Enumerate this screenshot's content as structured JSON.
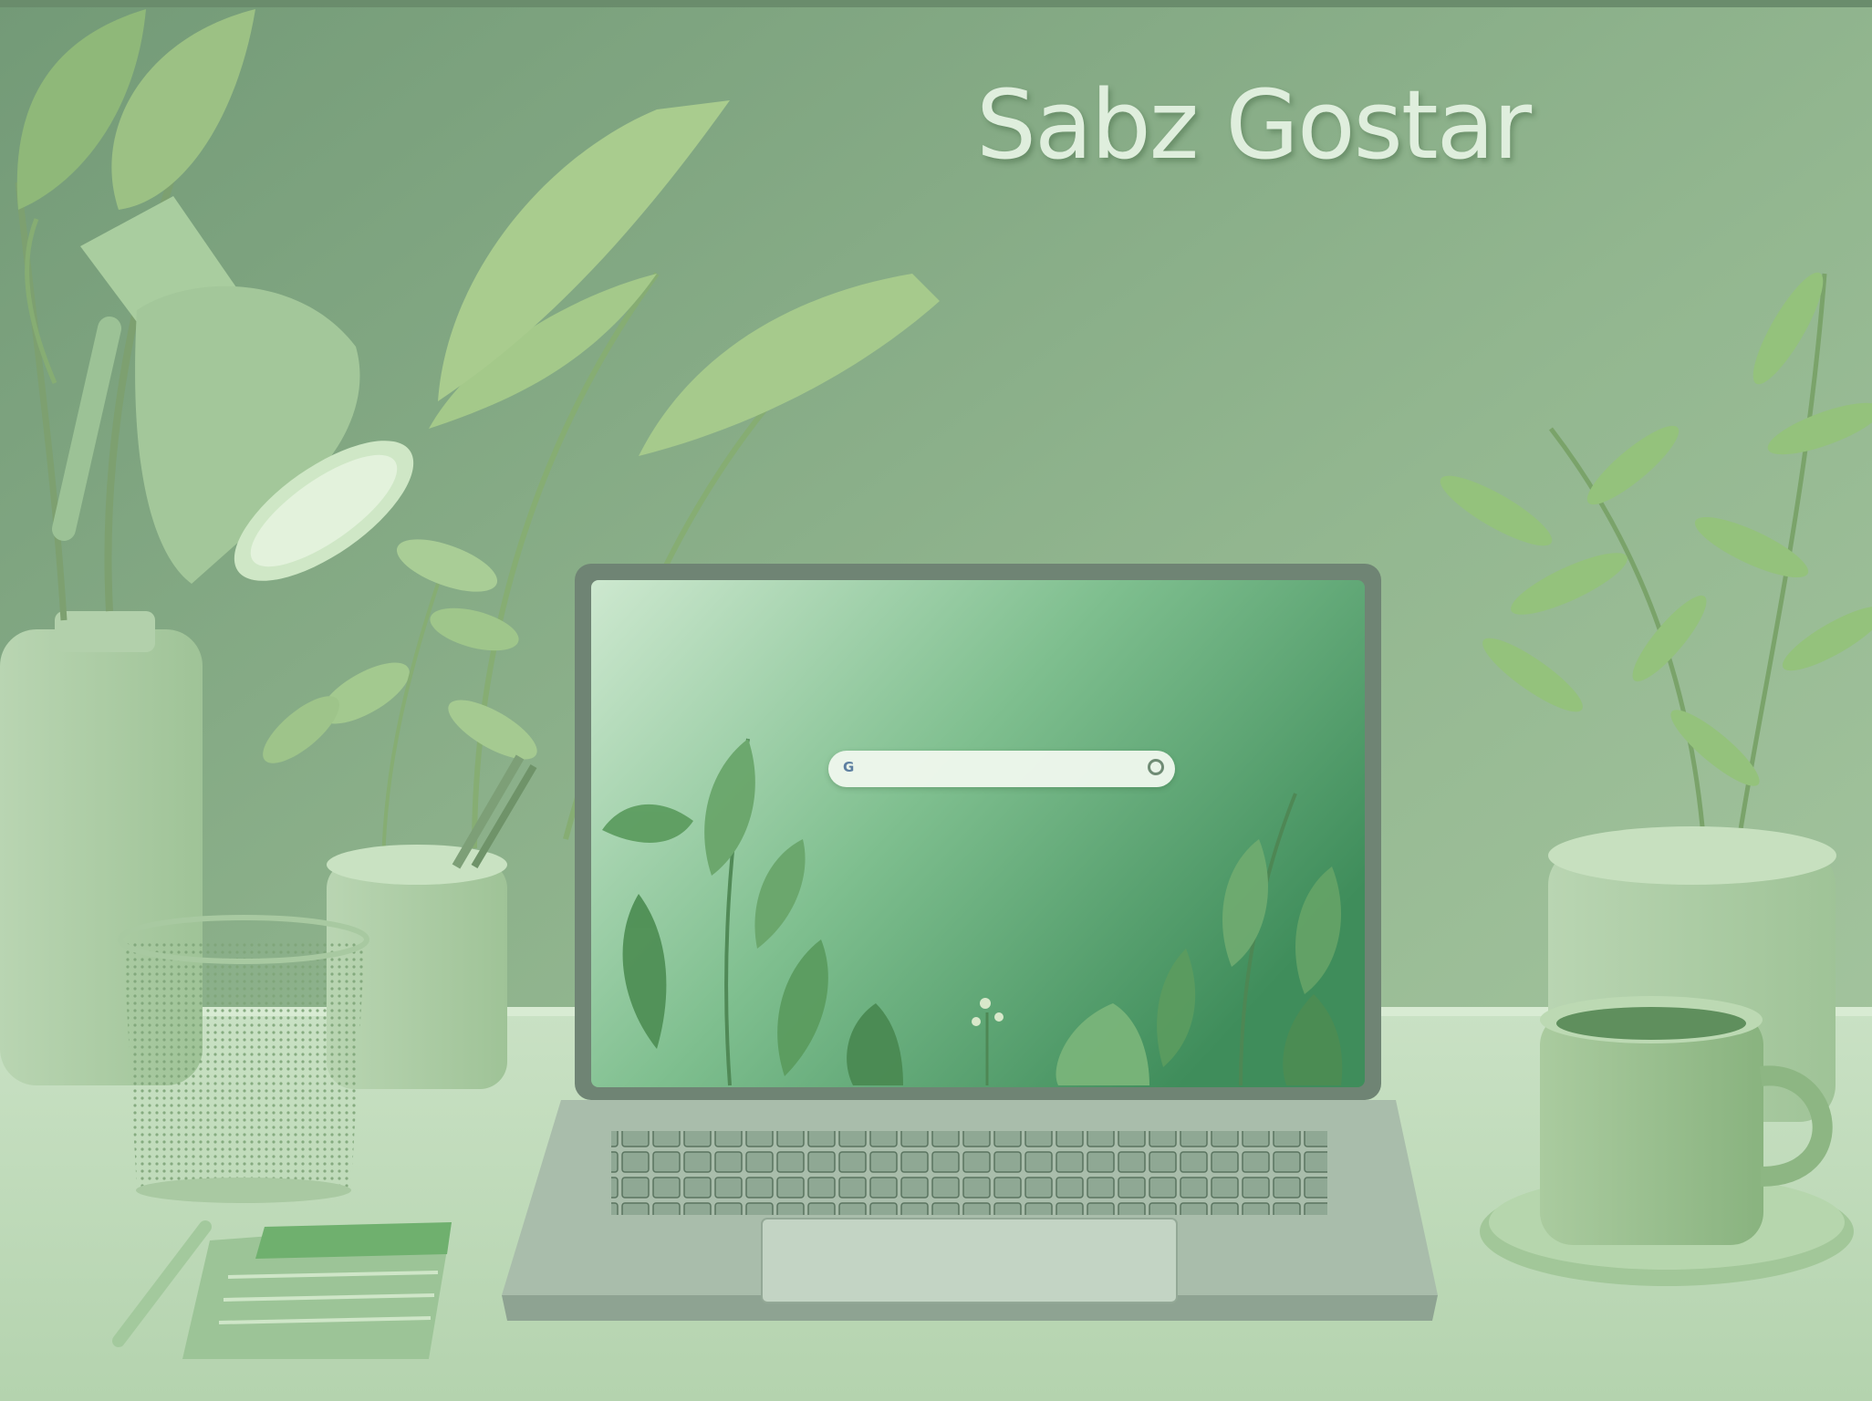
{
  "brand": {
    "title": "Sabz Gostar"
  },
  "laptop": {
    "search": {
      "placeholder": ""
    },
    "search_icon": "g-icon",
    "mic_icon": "mic-icon"
  },
  "colors": {
    "wall": "#8fb18b",
    "desk": "#c8e0c2",
    "leaf": "#8fbf76",
    "screen_dark": "#3f8f5b",
    "screen_light": "#cde8cf"
  }
}
